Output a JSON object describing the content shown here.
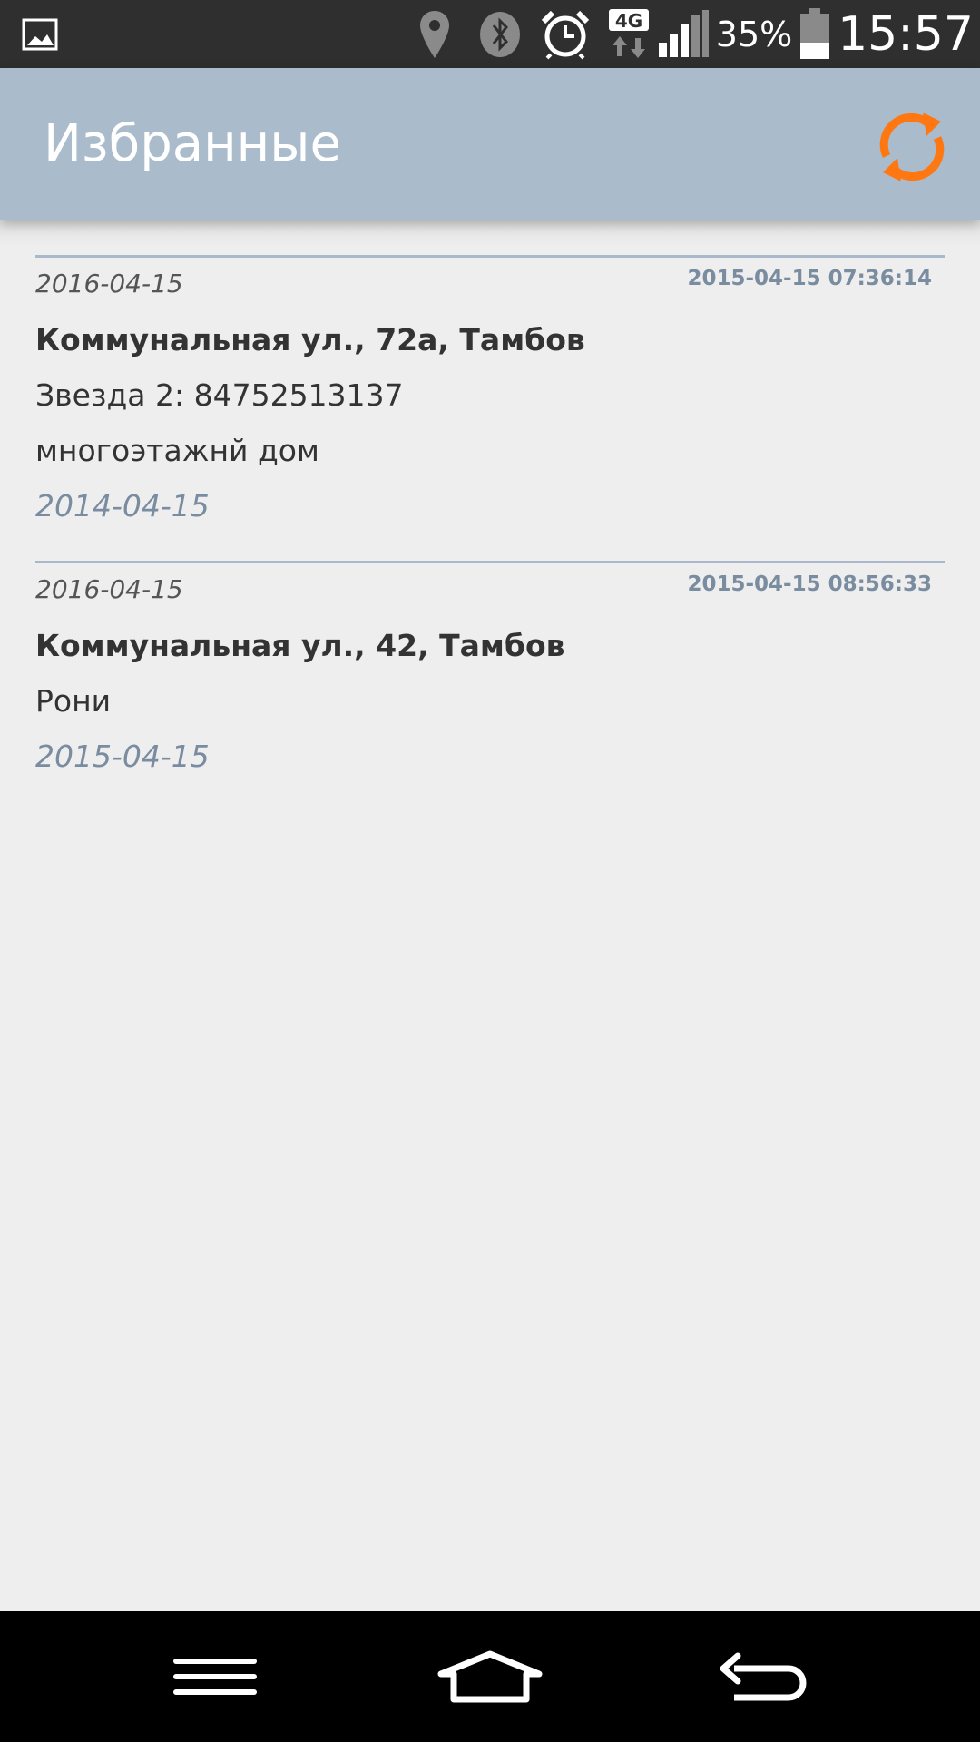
{
  "status_bar": {
    "battery_percent": "35%",
    "time": "15:57",
    "network_label": "4G",
    "battery_level": 0.35,
    "icons": [
      "gallery-icon",
      "location-icon",
      "bluetooth-icon",
      "alarm-icon",
      "network-4g-icon",
      "signal-icon",
      "battery-icon"
    ]
  },
  "app_bar": {
    "title": "Избранные",
    "refresh_icon": "refresh-icon",
    "accent_color": "#ff7711",
    "background_color": "#aabbcc"
  },
  "list": {
    "items": [
      {
        "date_top": "2016-04-15",
        "timestamp": "2015-04-15 07:36:14",
        "address": "Коммунальная ул., 72а, Тамбов",
        "lines": [
          "Звезда 2: 84752513137",
          "многоэтажнй дом"
        ],
        "date_bottom": "2014-04-15"
      },
      {
        "date_top": "2016-04-15",
        "timestamp": "2015-04-15 08:56:33",
        "address": "Коммунальная ул., 42, Тамбов",
        "lines": [
          "Рони"
        ],
        "date_bottom": "2015-04-15"
      }
    ]
  },
  "nav_bar": {
    "icons": [
      "menu-icon",
      "home-icon",
      "back-icon"
    ]
  }
}
